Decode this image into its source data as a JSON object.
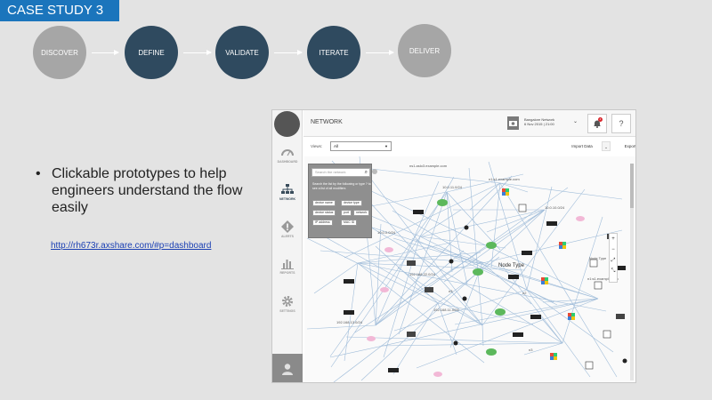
{
  "slide": {
    "tag": "CASE STUDY 3",
    "steps": [
      "DISCOVER",
      "DEFINE",
      "VALIDATE",
      "ITERATE",
      "DELIVER"
    ],
    "bullet": "Clickable prototypes to help engineers understand the flow easily",
    "link": "http://rh673r.axshare.com/#p=dashboard"
  },
  "app": {
    "page_title": "NETWORK",
    "nav": [
      {
        "label": "DASHBOARD",
        "icon": "dashboard-icon"
      },
      {
        "label": "NETWORK",
        "icon": "network-icon"
      },
      {
        "label": "ALERTS",
        "icon": "alert-icon"
      },
      {
        "label": "REPORTS",
        "icon": "reports-icon"
      },
      {
        "label": "SETTINGS",
        "icon": "settings-icon"
      }
    ],
    "network_selector": {
      "name": "Bangalore Network",
      "date": "6 Nov 2015 | 21:00"
    },
    "notification_count": "4",
    "help_label": "?",
    "views_label": "Views:",
    "views_value": "All",
    "import_label": "Import Data",
    "export_label": "Export Network",
    "search_placeholder": "Search the network",
    "search_help": "Search the list by the following or type ? to see a list of all modifiers",
    "chips": [
      "device name",
      "device type",
      "device status",
      "port",
      "network",
      "IP address",
      "MAC ID"
    ],
    "zoom": [
      "+",
      "−"
    ],
    "network_labels": [
      "10.0.11.0/24",
      "10.0.10.0/24",
      "10.0.0.0/24",
      "192.168.22.0/24",
      "192.168.11.0/24",
      "192.168.13.0/24",
      "n1:s1.example.com",
      "n3",
      "n2",
      "n3",
      "Node Type",
      "Node Type",
      "n1:s1.example.com",
      "ns1.aslo3.example.com"
    ]
  },
  "colors": {
    "accent": "#1b75bc",
    "step_grey": "#a6a6a6",
    "step_navy": "#2f4a5f",
    "link": "#1a3fb3"
  }
}
